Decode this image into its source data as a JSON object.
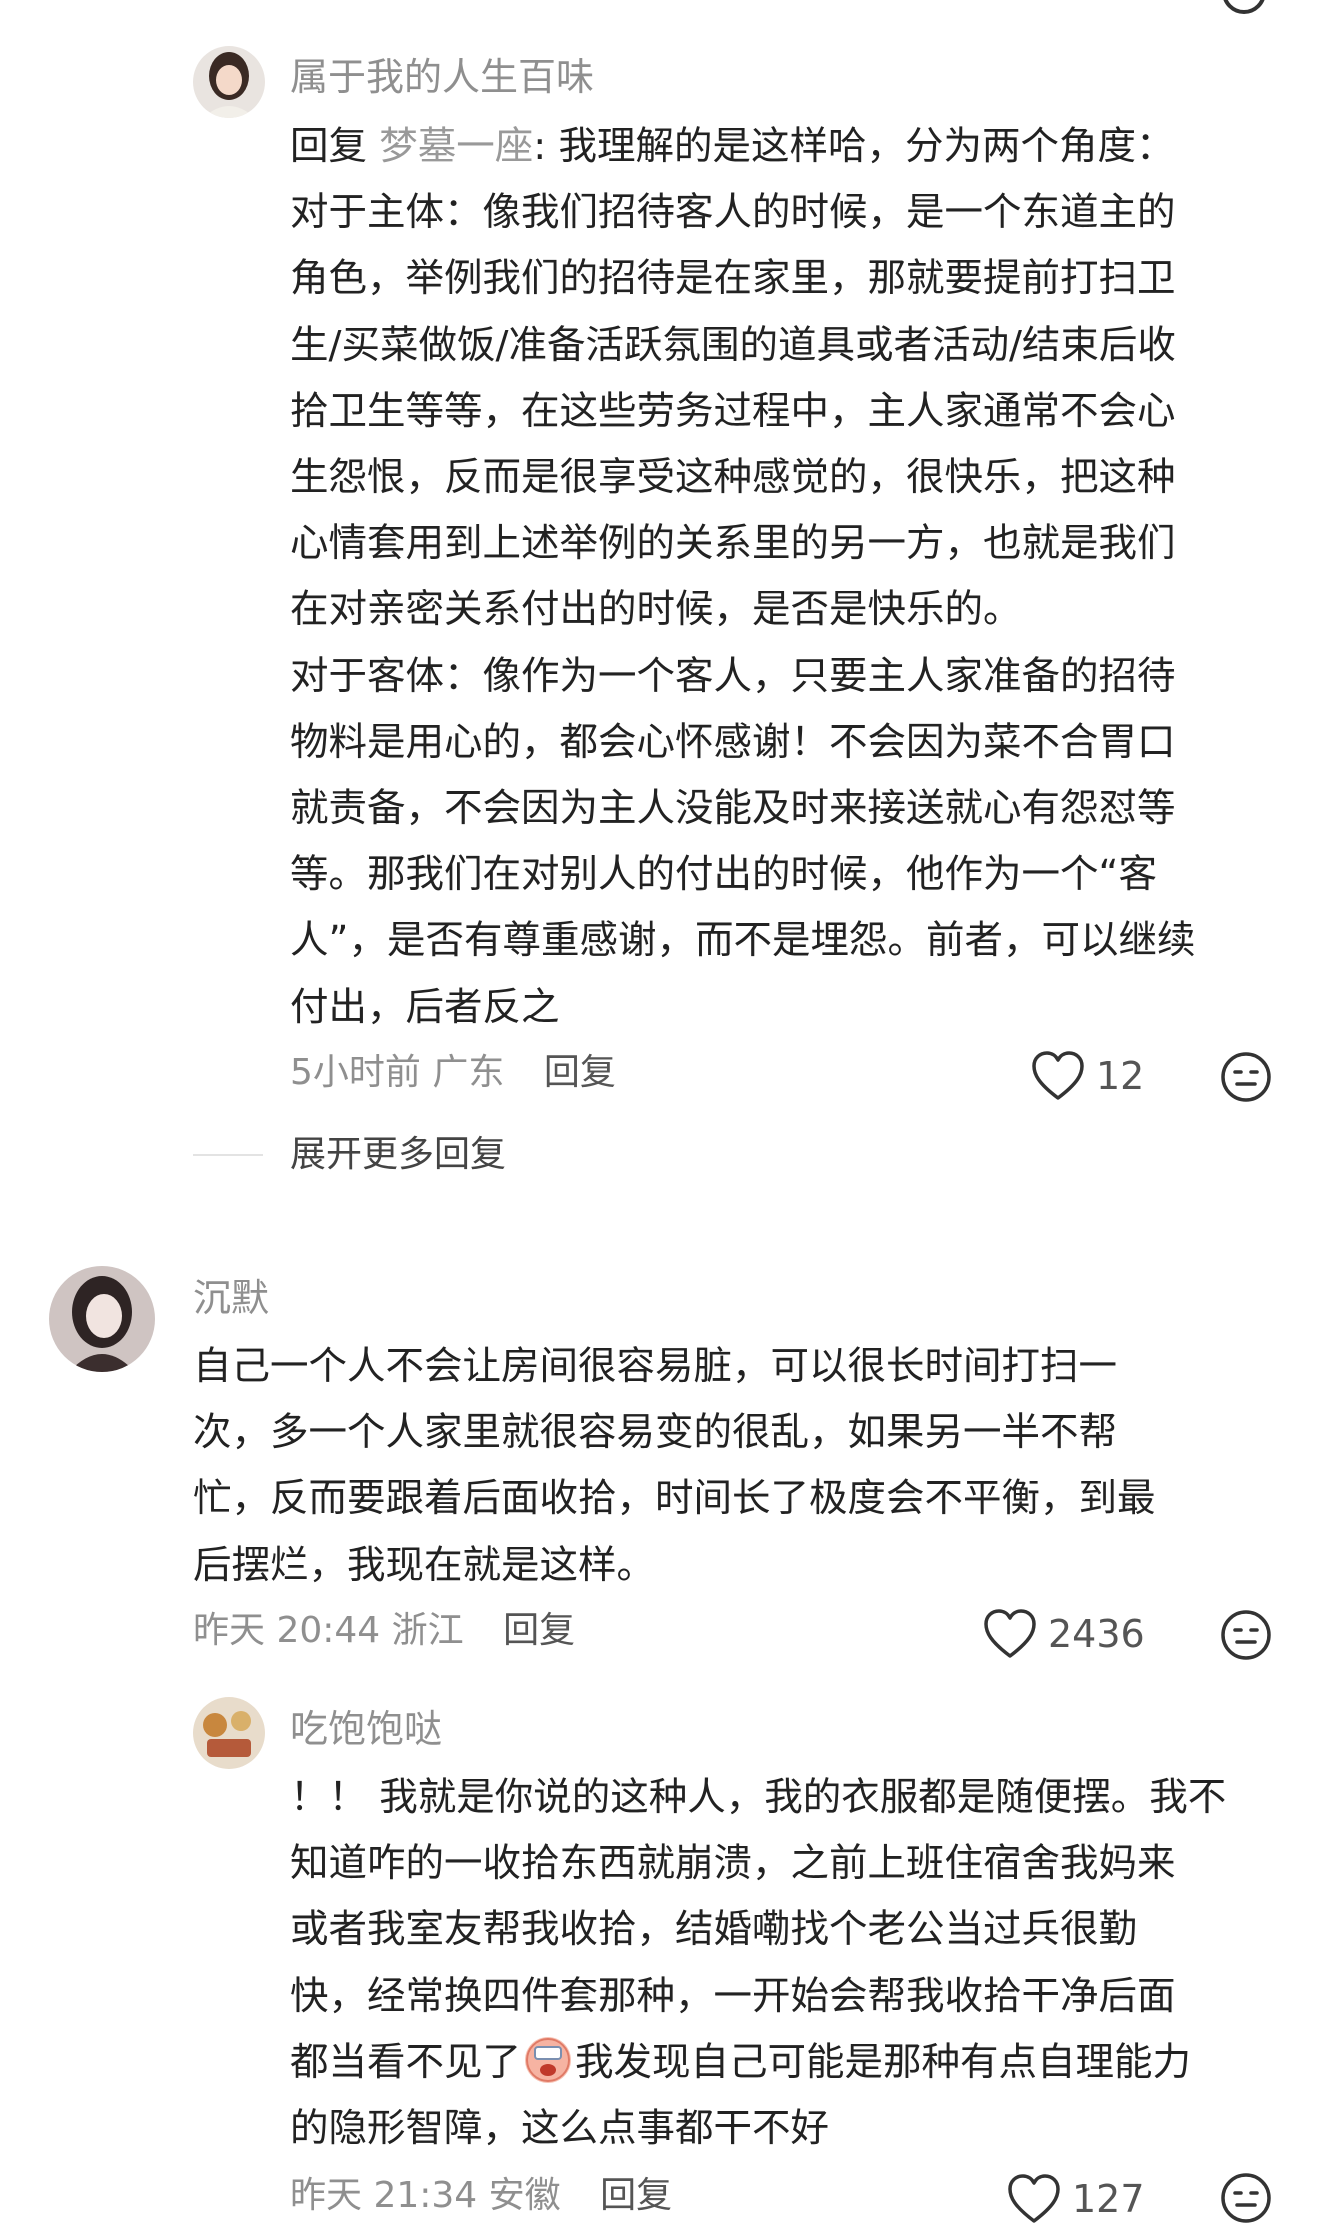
{
  "comments": [
    {
      "username": "属于我的人生百味",
      "reply_prefix": "回复 ",
      "reply_target": "梦墓一座",
      "text": ": 我理解的是这样哈，分为两个角度：\n对于主体：像我们招待客人的时候，是一个东道主的\n角色，举例我们的招待是在家里，那就要提前打扫卫\n生/买菜做饭/准备活跃氛围的道具或者活动/结束后收\n拾卫生等等，在这些劳务过程中，主人家通常不会心\n生怨恨，反而是很享受这种感觉的，很快乐，把这种\n心情套用到上述举例的关系里的另一方，也就是我们\n在对亲密关系付出的时候，是否是快乐的。\n对于客体：像作为一个客人，只要主人家准备的招待\n物料是用心的，都会心怀感谢！不会因为菜不合胃口\n就责备，不会因为主人没能及时来接送就心有怨怼等\n等。那我们在对别人的付出的时候，他作为一个“客\n人”，是否有尊重感谢，而不是埋怨。前者，可以继续\n付出，后者反之",
      "time": "5小时前",
      "location": "广东",
      "reply_label": "回复",
      "likes": "12"
    },
    {
      "username": "沉默",
      "text": "自己一个人不会让房间很容易脏，可以很长时间打扫一\n次，多一个人家里就很容易变的很乱，如果另一半不帮\n忙，反而要跟着后面收拾，时间长了极度会不平衡，到最\n后摆烂，我现在就是这样。",
      "time": "昨天 20:44",
      "location": "浙江",
      "reply_label": "回复",
      "likes": "2436"
    },
    {
      "username": "吃饱饱哒",
      "text_before_emoji": "！！ 我就是你说的这种人，我的衣服都是随便摆。我不\n知道咋的一收拾东西就崩溃，之前上班住宿舍我妈来\n或者我室友帮我收拾，结婚嘞找个老公当过兵很勤\n快，经常换四件套那种，一开始会帮我收拾干净后面\n都当看不见了",
      "text_after_emoji": "我发现自己可能是那种有点自理能力\n的隐形智障，这么点事都干不好",
      "time": "昨天 21:34",
      "location": "安徽",
      "reply_label": "回复",
      "likes": "127"
    }
  ],
  "expand_more": "展开更多回复",
  "icons": {
    "like": "heart-outline-icon",
    "emoji": "emoji-face-icon",
    "inline": "crying-face-emoji"
  },
  "colors": {
    "text": "#222222",
    "muted": "#8f8f8f",
    "divider": "#e3e3e3"
  }
}
